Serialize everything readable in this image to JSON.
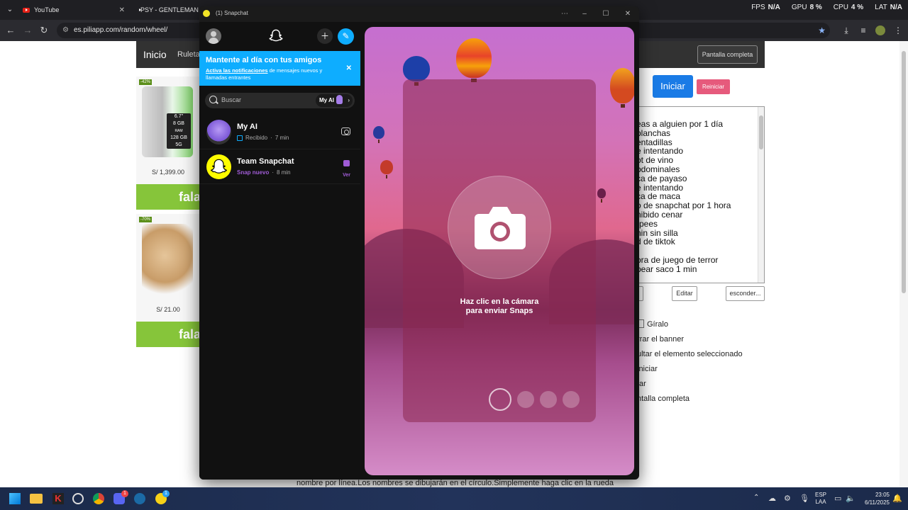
{
  "browser": {
    "tabs": [
      {
        "title": "YouTube"
      },
      {
        "title": "PSY - GENTLEMAN M"
      }
    ],
    "perf": [
      {
        "label": "FPS",
        "value": "N/A"
      },
      {
        "label": "GPU",
        "value": "8 %"
      },
      {
        "label": "CPU",
        "value": "4 %"
      },
      {
        "label": "LAT",
        "value": "N/A"
      }
    ],
    "url": "es.piliapp.com/random/wheel/"
  },
  "site": {
    "home": "Inicio",
    "ruleta": "Ruleta",
    "fullscreen_button": "Pantalla completa",
    "start_button": "Iniciar",
    "reset_button": "Reiniciar",
    "wheel_lines": [
      "eas a alguien por 1 día",
      "planchas",
      "entadillas",
      "e intentando",
      "ot de vino",
      "bdominales",
      "ca de payaso",
      "e intentando",
      "ca de maca",
      "o de snapchat por 1 hora",
      "nibido cenar",
      "rpees",
      "nin sin silla",
      "d de tiktok",
      "",
      "ora de juego de terror",
      "pear saco 1 min"
    ],
    "edit_button": "Editar",
    "hide_button": "esconder...",
    "options": [
      "Gíralo",
      "rrar el banner",
      "ultar el elemento seleccionado",
      "iniciar",
      "tar",
      "ntalla completa"
    ],
    "bottom_text": "nombre por línea.Los nombres se dibujarán en el círculo.Simplemente haga clic en la rueda",
    "ads": [
      {
        "discount": "-42%",
        "price": "S/ 1,399.00",
        "brand": "falab"
      },
      {
        "discount": "-70%",
        "price": "S/ 21.00",
        "brand": "falab"
      }
    ],
    "phone_specs": [
      "6.7\"",
      "8 GB",
      "RAM",
      "128 GB",
      "5G"
    ]
  },
  "snapchat": {
    "window_title": "(1) Snapchat",
    "banner": {
      "title": "Mantente al día con tus amigos",
      "link": "Activa las notificaciones",
      "text": " de mensajes nuevos y llamadas entrantes"
    },
    "search_placeholder": "Buscar",
    "myai_chip": "My AI",
    "chats": [
      {
        "name": "My AI",
        "status": "Recibido",
        "time": "7 min"
      },
      {
        "name": "Team Snapchat",
        "status": "Snap nuevo",
        "time": "8 min",
        "action": "Ver"
      }
    ],
    "camera_hint_line1": "Haz clic en la cámara",
    "camera_hint_line2": "para enviar Snaps",
    "colors": {
      "accent": "#0eadff",
      "snap_purple": "#a05cd6",
      "snap_yellow": "#fffc00"
    }
  },
  "taskbar": {
    "lang_top": "ESP",
    "lang_bottom": "LAA",
    "time": "23:05",
    "date": "6/11/2025",
    "steam_badge": "1",
    "discord_badge": "1"
  }
}
